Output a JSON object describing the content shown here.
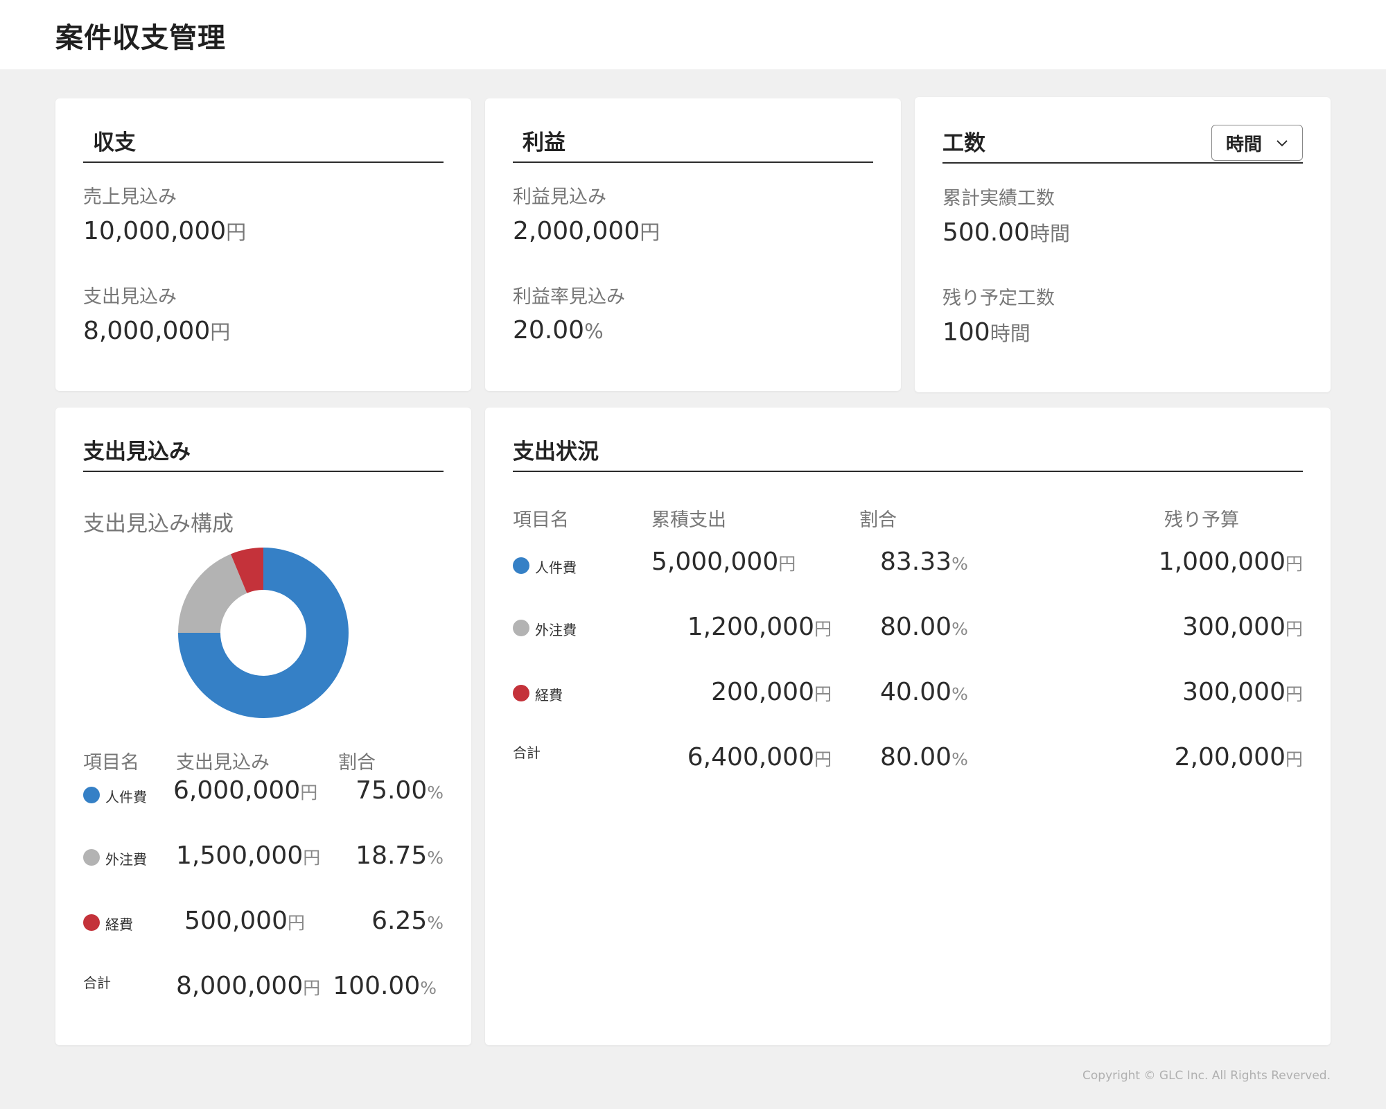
{
  "header": {
    "title": "案件収支管理"
  },
  "cards": {
    "balance": {
      "title": "収支",
      "sales_label": "売上見込み",
      "sales_value": "10,000,000",
      "sales_unit": "円",
      "expense_label": "支出見込み",
      "expense_value": "8,000,000",
      "expense_unit": "円"
    },
    "profit": {
      "title": "利益",
      "profit_label": "利益見込み",
      "profit_value": "2,000,000",
      "profit_unit": "円",
      "rate_label": "利益率見込み",
      "rate_value": "20.00",
      "rate_unit": "%"
    },
    "effort": {
      "title": "工数",
      "unit_select": "時間",
      "actual_label": "累計実績工数",
      "actual_value": "500.00",
      "actual_unit": "時間",
      "remaining_label": "残り予定工数",
      "remaining_value": "100",
      "remaining_unit": "時間"
    }
  },
  "expense_forecast": {
    "title": "支出見込み",
    "subtitle": "支出見込み構成",
    "headers": [
      "項目名",
      "支出見込み",
      "割合"
    ],
    "rows": [
      {
        "name": "人件費",
        "amount": "6,000,000",
        "unit": "円",
        "ratio": "75.00",
        "ratio_unit": "%"
      },
      {
        "name": "外注費",
        "amount": "1,500,000",
        "unit": "円",
        "ratio": "18.75",
        "ratio_unit": "%"
      },
      {
        "name": "経費",
        "amount": "500,000",
        "unit": "円",
        "ratio": "6.25",
        "ratio_unit": "%"
      },
      {
        "name": "合計",
        "amount": "8,000,000",
        "unit": "円",
        "ratio": "100.00",
        "ratio_unit": "%"
      }
    ]
  },
  "expense_status": {
    "title": "支出状況",
    "headers": [
      "項目名",
      "累積支出",
      "割合",
      "残り予算"
    ],
    "rows": [
      {
        "name": "人件費",
        "spent": "5,000,000",
        "unit": "円",
        "ratio": "83.33",
        "ratio_unit": "%",
        "remaining": "1,000,000",
        "remaining_unit": "円"
      },
      {
        "name": "外注費",
        "spent": "1,200,000",
        "unit": "円",
        "ratio": "80.00",
        "ratio_unit": "%",
        "remaining": "300,000",
        "remaining_unit": "円"
      },
      {
        "name": "経費",
        "spent": "200,000",
        "unit": "円",
        "ratio": "40.00",
        "ratio_unit": "%",
        "remaining": "300,000",
        "remaining_unit": "円"
      },
      {
        "name": "合計",
        "spent": "6,400,000",
        "unit": "円",
        "ratio": "80.00",
        "ratio_unit": "%",
        "remaining": "2,00,000",
        "remaining_unit": "円"
      }
    ]
  },
  "colors": {
    "personnel": "#3580c6",
    "outsourcing": "#b3b3b3",
    "expenses": "#c4323a"
  },
  "chart_data": {
    "type": "pie",
    "categories": [
      "人件費",
      "外注費",
      "経費"
    ],
    "values": [
      75.0,
      18.75,
      6.25
    ],
    "colors": [
      "#3580c6",
      "#b3b3b3",
      "#c4323a"
    ],
    "title": "支出見込み構成",
    "donut": true
  },
  "footer": {
    "copyright": "Copyright © GLC Inc. All Rights Reverved."
  }
}
